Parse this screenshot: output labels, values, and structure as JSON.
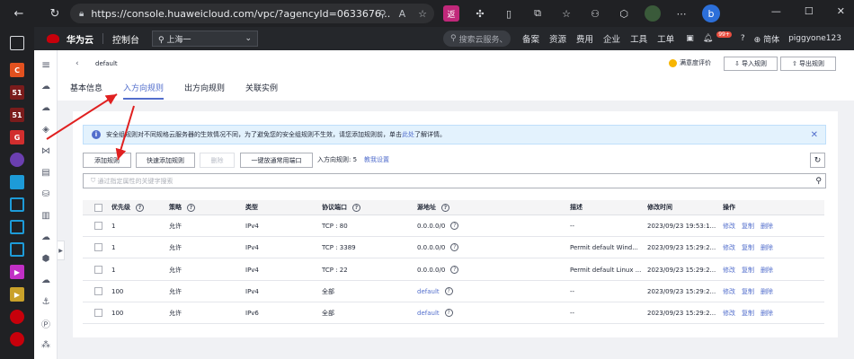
{
  "browser": {
    "url": "https://console.huaweicloud.com/vpc/?agencyId=0633676..."
  },
  "topnav": {
    "brand": "华为云",
    "console": "控制台",
    "region": "上海一",
    "search_placeholder": "搜索云服务、",
    "links": [
      "备案",
      "资源",
      "费用",
      "企业",
      "工具",
      "工单"
    ],
    "badge": "99+",
    "lang": "简体",
    "user": "piggyone123"
  },
  "header": {
    "sg_name": "default",
    "satisfaction": "满意度评价",
    "import_btn": "导入规则",
    "export_btn": "导出规则",
    "tabs": [
      "基本信息",
      "入方向规则",
      "出方向规则",
      "关联实例"
    ],
    "active_tab": 1
  },
  "info": {
    "text": "安全组规则对不同规格云服务器的生效情况不同，为了避免您的安全组规则不生效，请您添加规则前，单击",
    "link": "此处",
    "tail": "了解详情。"
  },
  "toolbar": {
    "add": "添加规则",
    "quick_add": "快速添加规则",
    "delete": "删除",
    "open_ports": "一键放通常用端口",
    "count_label": "入方向规则: 5",
    "quota_link": "教我设置"
  },
  "filter": {
    "placeholder": "通过指定属性的关键字搜索"
  },
  "table": {
    "headers": [
      "优先级",
      "策略",
      "类型",
      "协议端口",
      "源地址",
      "描述",
      "修改时间",
      "操作"
    ],
    "rows": [
      {
        "priority": "1",
        "policy": "允许",
        "type": "IPv4",
        "port": "TCP : 80",
        "source": "0.0.0.0/0",
        "source_link": false,
        "desc": "--",
        "time": "2023/09/23 19:53:1..."
      },
      {
        "priority": "1",
        "policy": "允许",
        "type": "IPv4",
        "port": "TCP : 3389",
        "source": "0.0.0.0/0",
        "source_link": false,
        "desc": "Permit default Wind...",
        "time": "2023/09/23 15:29:2..."
      },
      {
        "priority": "1",
        "policy": "允许",
        "type": "IPv4",
        "port": "TCP : 22",
        "source": "0.0.0.0/0",
        "source_link": false,
        "desc": "Permit default Linux ...",
        "time": "2023/09/23 15:29:2..."
      },
      {
        "priority": "100",
        "policy": "允许",
        "type": "IPv4",
        "port": "全部",
        "source": "default",
        "source_link": true,
        "desc": "--",
        "time": "2023/09/23 15:29:2..."
      },
      {
        "priority": "100",
        "policy": "允许",
        "type": "IPv6",
        "port": "全部",
        "source": "default",
        "source_link": true,
        "desc": "--",
        "time": "2023/09/23 15:29:2..."
      }
    ],
    "ops": [
      "修改",
      "复制",
      "删除"
    ]
  },
  "colors": {
    "accent": "#526ecc",
    "annotation_arrow": "#e02020",
    "nav_bg": "#25272b"
  }
}
